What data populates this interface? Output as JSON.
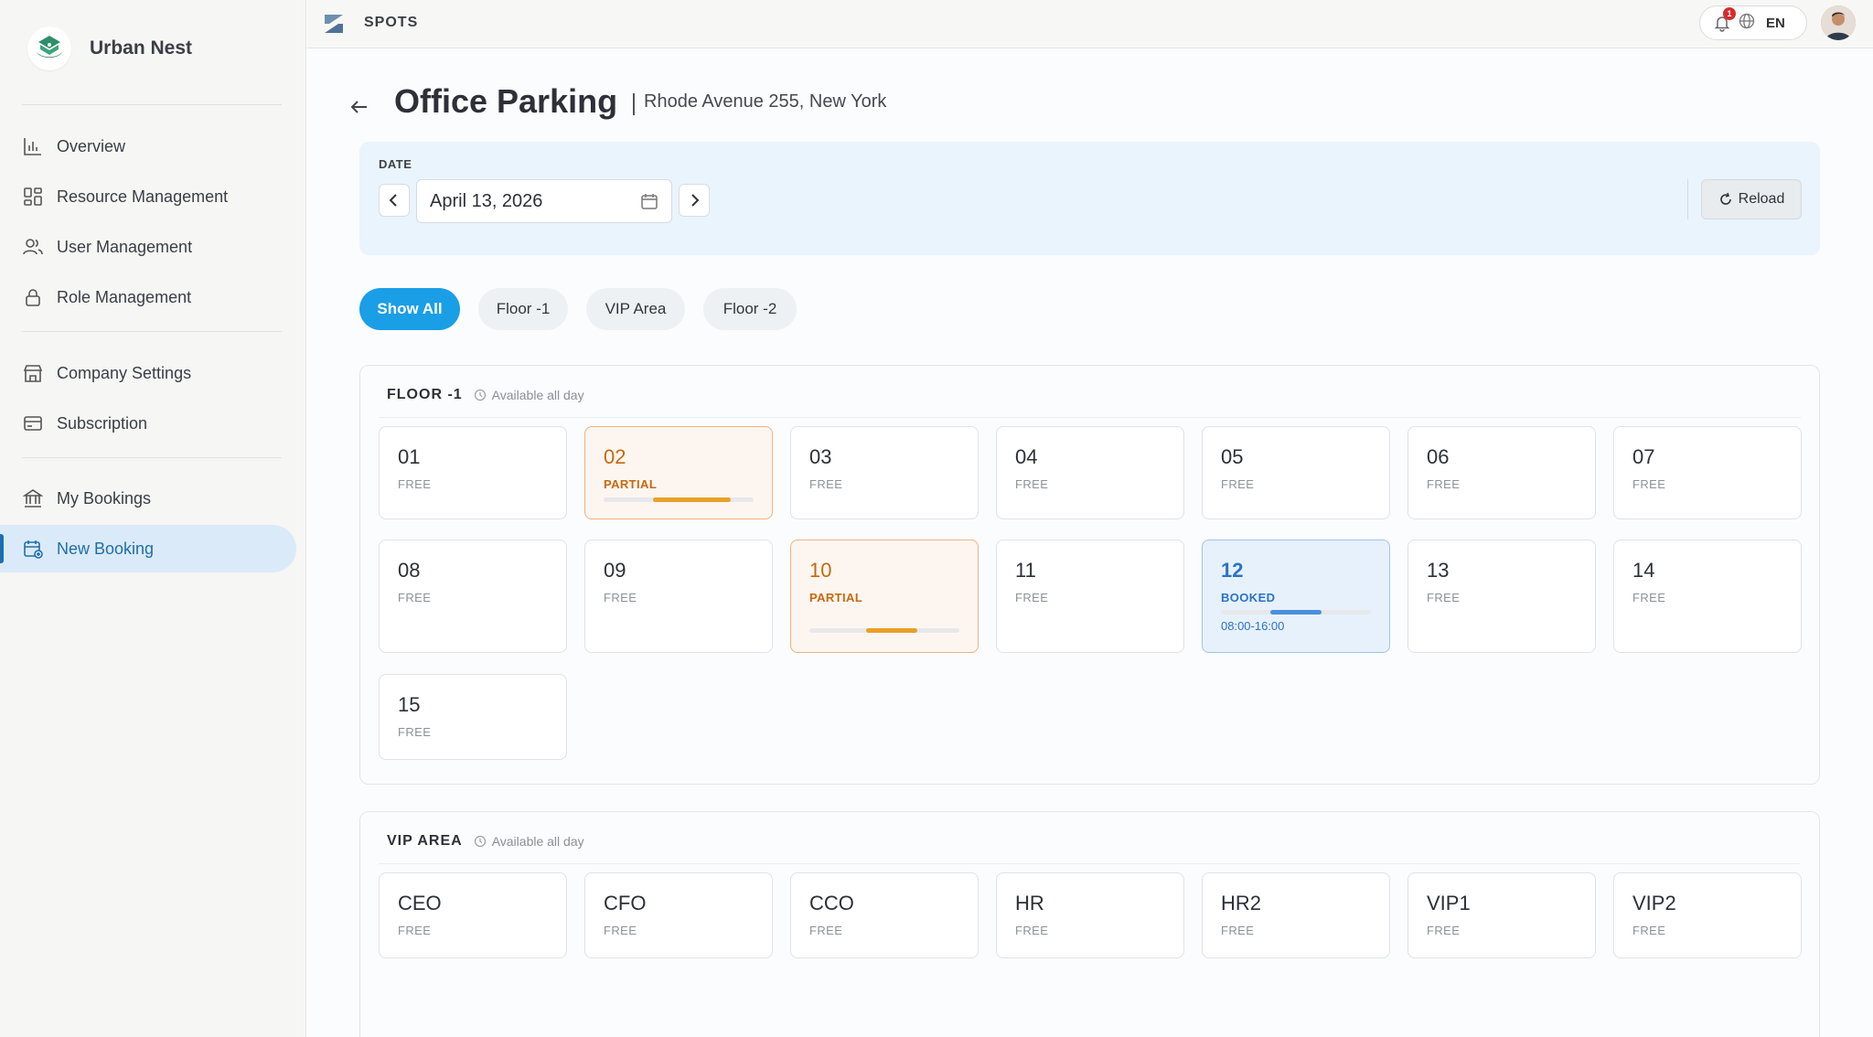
{
  "brand": {
    "name": "Urban Nest"
  },
  "sidebar": {
    "items": [
      {
        "label": "Overview",
        "icon": "chart-bar-icon"
      },
      {
        "label": "Resource Management",
        "icon": "grid-icon"
      },
      {
        "label": "User Management",
        "icon": "users-icon"
      },
      {
        "label": "Role Management",
        "icon": "lock-icon"
      },
      {
        "label": "Company Settings",
        "icon": "building-icon"
      },
      {
        "label": "Subscription",
        "icon": "card-icon"
      },
      {
        "label": "My Bookings",
        "icon": "bank-icon"
      },
      {
        "label": "New Booking",
        "icon": "calendar-add-icon",
        "active": true
      }
    ],
    "collapse_label": "«"
  },
  "topbar": {
    "app_name": "SPOTS",
    "notifications_count": "1",
    "language": "EN"
  },
  "page": {
    "title": "Office Parking",
    "subtitle": "Rhode Avenue 255, New York"
  },
  "date_panel": {
    "label": "DATE",
    "value": "April 13, 2026",
    "reload_label": "Reload"
  },
  "filters": [
    "Show All",
    "Floor -1",
    "VIP Area",
    "Floor -2"
  ],
  "sections": {
    "floor1": {
      "title": "FLOOR -1",
      "availability": "Available all day",
      "spots": [
        {
          "num": "01",
          "status": "FREE"
        },
        {
          "num": "02",
          "status": "PARTIAL",
          "booked_from": 0.33,
          "booked_to": 0.85
        },
        {
          "num": "03",
          "status": "FREE"
        },
        {
          "num": "04",
          "status": "FREE"
        },
        {
          "num": "05",
          "status": "FREE"
        },
        {
          "num": "06",
          "status": "FREE"
        },
        {
          "num": "07",
          "status": "FREE"
        },
        {
          "num": "08",
          "status": "FREE"
        },
        {
          "num": "09",
          "status": "FREE"
        },
        {
          "num": "10",
          "status": "PARTIAL",
          "booked_from": 0.38,
          "booked_to": 0.72
        },
        {
          "num": "11",
          "status": "FREE"
        },
        {
          "num": "12",
          "status": "BOOKED",
          "booked_from": 0.33,
          "booked_to": 0.67,
          "time": "08:00-16:00"
        },
        {
          "num": "13",
          "status": "FREE"
        },
        {
          "num": "14",
          "status": "FREE"
        },
        {
          "num": "15",
          "status": "FREE"
        }
      ]
    },
    "vip": {
      "title": "VIP AREA",
      "availability": "Available all day",
      "spots": [
        {
          "num": "CEO",
          "status": "FREE"
        },
        {
          "num": "CFO",
          "status": "FREE"
        },
        {
          "num": "CCO",
          "status": "FREE"
        },
        {
          "num": "HR",
          "status": "FREE"
        },
        {
          "num": "HR2",
          "status": "FREE"
        },
        {
          "num": "VIP1",
          "status": "FREE"
        },
        {
          "num": "VIP2",
          "status": "FREE"
        }
      ]
    }
  },
  "colors": {
    "accent": "#1a9ee6",
    "partial": "#e9a028",
    "booked": "#4a8fdc",
    "active_nav": "#dbeaf8"
  }
}
